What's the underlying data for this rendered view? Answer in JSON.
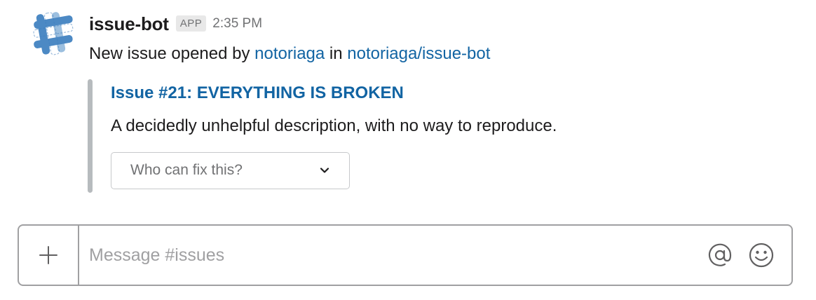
{
  "message": {
    "sender": "issue-bot",
    "badge": "APP",
    "timestamp": "2:35 PM",
    "avatar_icon": "slack-hash-logo-icon",
    "text_prefix": "New issue opened by",
    "author_link": "notoriaga",
    "text_middle": "in",
    "repo_link": "notoriaga/issue-bot",
    "attachment": {
      "title": "Issue #21: EVERYTHING IS BROKEN",
      "text": "A decidedly unhelpful description, with no way to reproduce.",
      "select": {
        "placeholder": "Who can fix this?",
        "icon": "chevron-down-icon"
      }
    }
  },
  "composer": {
    "placeholder": "Message #issues",
    "add_icon": "plus-icon",
    "mention_icon": "at-sign-icon",
    "emoji_icon": "smiley-icon"
  },
  "colors": {
    "link": "#1264a3",
    "muted": "#717274",
    "attachment_bar": "#b7bbbe",
    "composer_border": "#a0a0a2",
    "logo": "#3d7fbf"
  }
}
